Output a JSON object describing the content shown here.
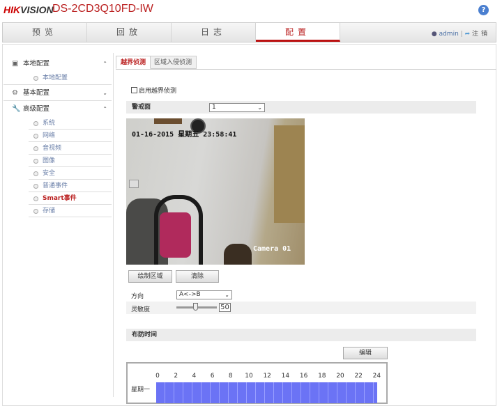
{
  "header": {
    "brand_a": "HIK",
    "brand_b": "VISION",
    "model": "DS-2CD3Q10FD-IW",
    "help": "?"
  },
  "nav": {
    "tabs": [
      "预览",
      "回放",
      "日志",
      "配置"
    ],
    "user": "admin",
    "logout": "注销"
  },
  "sidebar": {
    "local": {
      "label": "本地配置",
      "items": [
        "本地配置"
      ]
    },
    "basic": {
      "label": "基本配置"
    },
    "advanced": {
      "label": "高级配置",
      "items": [
        "系统",
        "网络",
        "音视频",
        "图像",
        "安全",
        "普通事件",
        "Smart事件",
        "存储"
      ]
    }
  },
  "main": {
    "tabs": [
      "越界侦测",
      "区域入侵侦测"
    ],
    "enable_label": "启用越界侦测",
    "warning_plane_label": "警戒面",
    "warning_plane_value": "1",
    "video": {
      "osd_time": "01-16-2015 星期五 23:58:41",
      "osd_name": "Camera 01"
    },
    "draw_button": "绘制区域",
    "clear_button": "清除",
    "direction_label": "方向",
    "direction_value": "A<->B",
    "sensitivity_label": "灵敏度",
    "sensitivity_value": "50",
    "schedule_label": "布防时间",
    "edit_button": "编辑",
    "hours": [
      "0",
      "2",
      "4",
      "6",
      "8",
      "10",
      "12",
      "14",
      "16",
      "18",
      "20",
      "22",
      "24"
    ],
    "day": "星期一"
  }
}
